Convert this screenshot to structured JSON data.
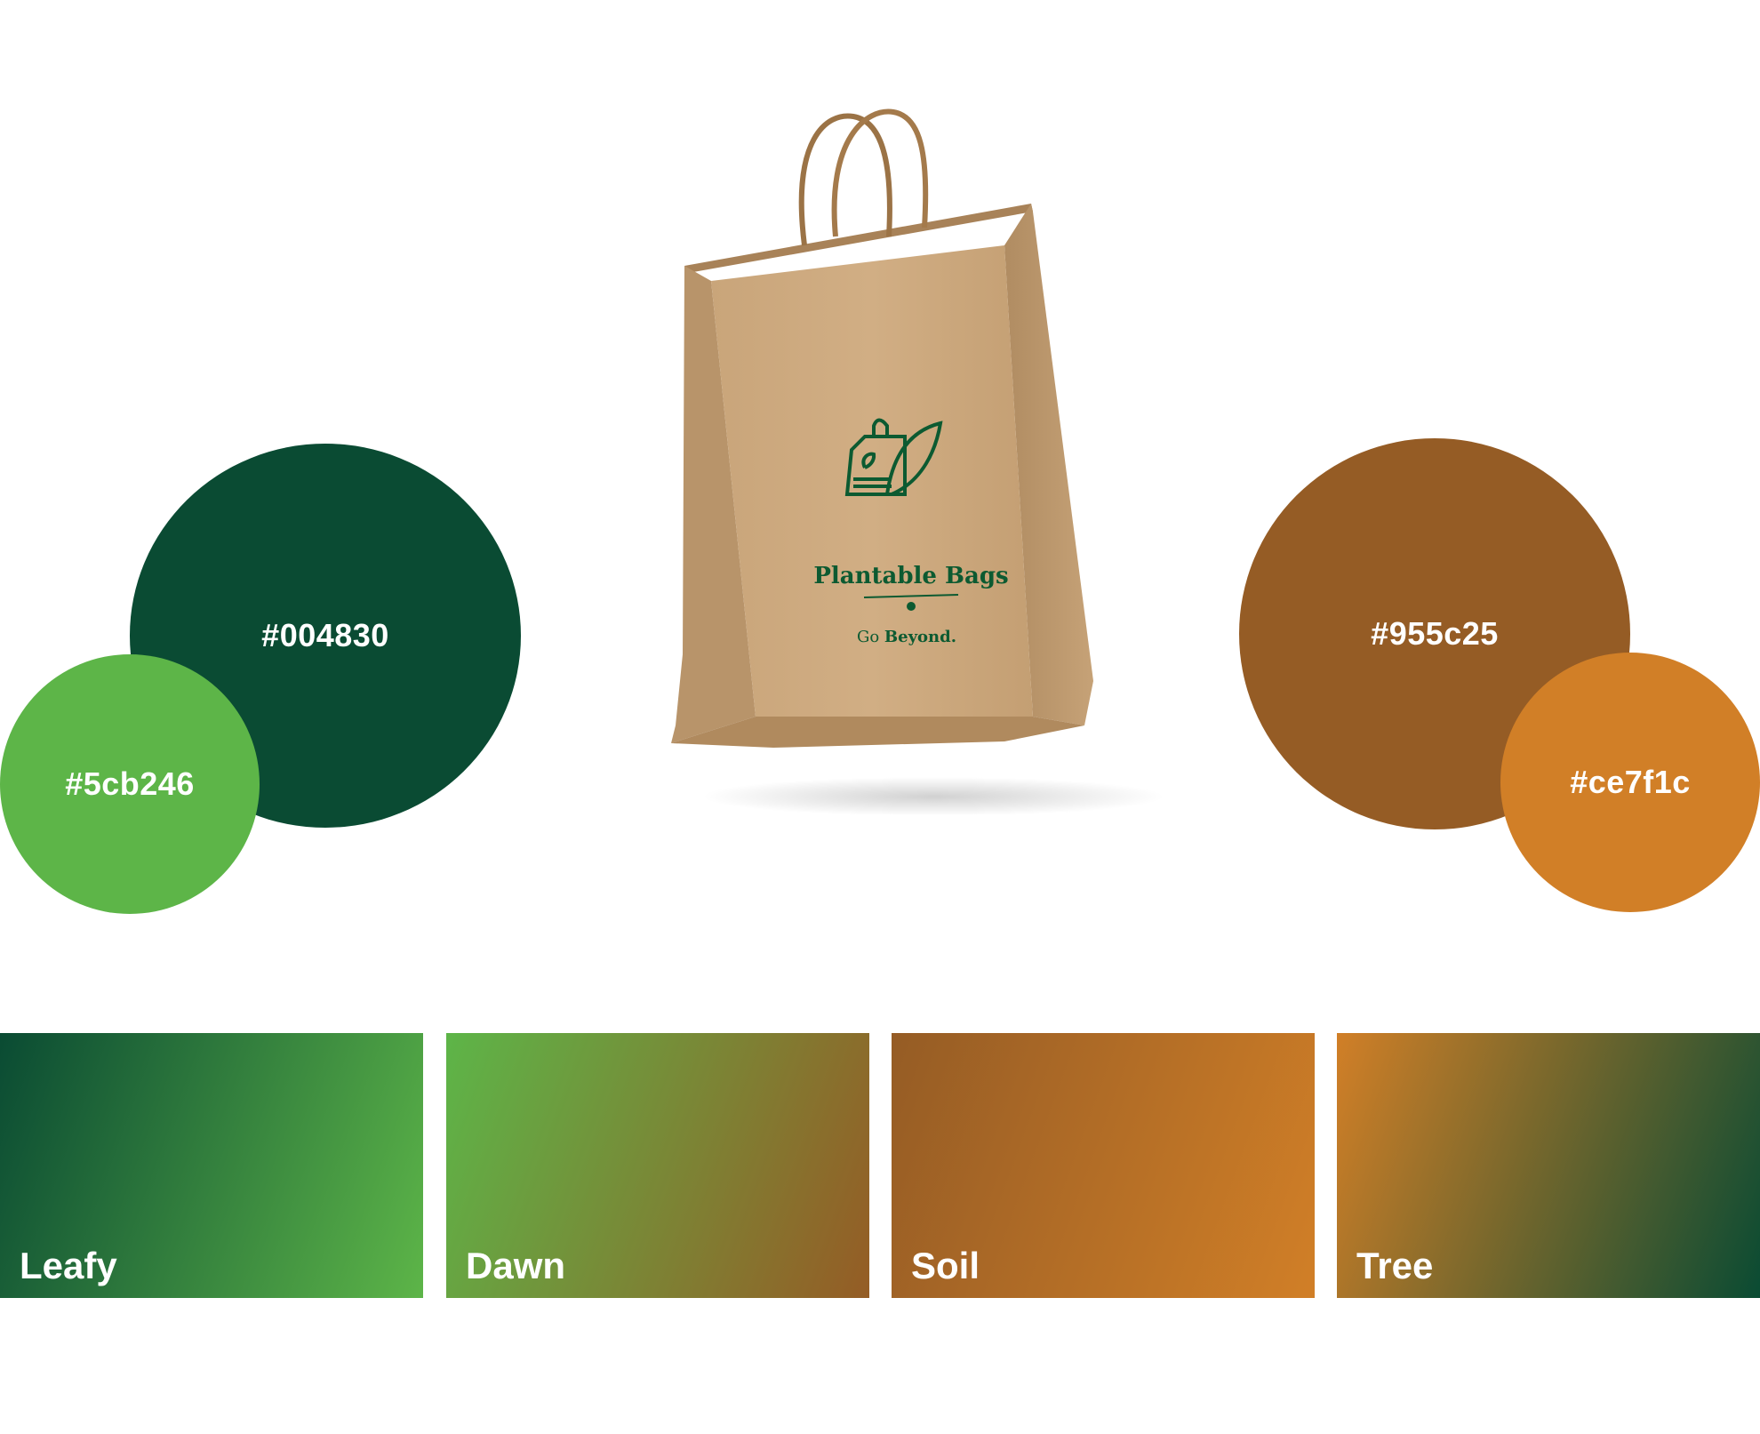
{
  "palette": {
    "dark_green": "#004830",
    "light_green": "#5cb246",
    "brown": "#955c25",
    "orange": "#ce7f1c"
  },
  "circles": [
    {
      "id": "dark_green",
      "label": "#004830",
      "color": "#0a4b33"
    },
    {
      "id": "light_green",
      "label": "#5cb246",
      "color": "#5db548"
    },
    {
      "id": "brown",
      "label": "#955c25",
      "color": "#955c25"
    },
    {
      "id": "orange",
      "label": "#ce7f1c",
      "color": "#d17f27"
    }
  ],
  "swatches": [
    {
      "label": "Leafy",
      "from": "#0a4b33",
      "to": "#5db548"
    },
    {
      "label": "Dawn",
      "from": "#5db548",
      "to": "#955c25"
    },
    {
      "label": "Soil",
      "from": "#955c25",
      "to": "#d17f27"
    },
    {
      "label": "Tree",
      "from": "#d17f27",
      "to": "#0a4b33"
    }
  ],
  "bag": {
    "brand": "Plantable Bags",
    "tagline_prefix": "Go ",
    "tagline_bold": "Beyond."
  }
}
